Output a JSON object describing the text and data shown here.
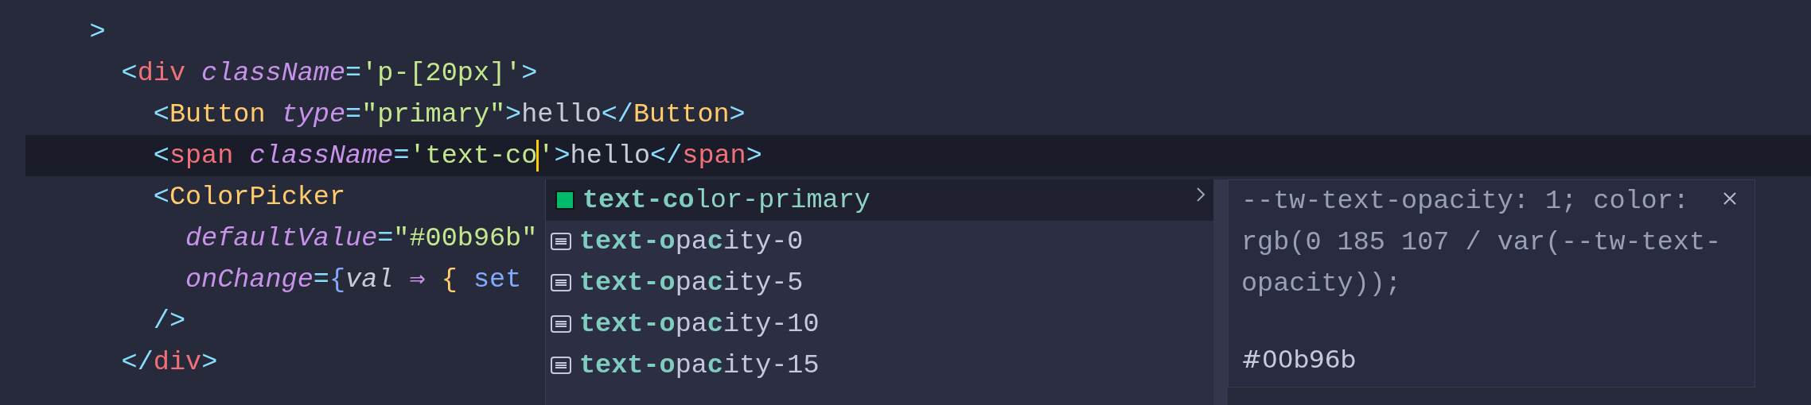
{
  "editor": {
    "lines": [
      {
        "current": false,
        "tokens": [
          {
            "text": ">",
            "kind": "punct"
          }
        ],
        "children": [
          {
            "current": false,
            "tokens": [
              {
                "text": "<",
                "kind": "punct"
              },
              {
                "text": "div",
                "kind": "tag"
              },
              {
                "text": " className",
                "kind": "attr"
              },
              {
                "text": "=",
                "kind": "punct"
              },
              {
                "text": "'p-[20px]'",
                "kind": "string"
              },
              {
                "text": ">",
                "kind": "punct"
              }
            ],
            "children": [
              {
                "current": false,
                "tokens": [
                  {
                    "text": "<",
                    "kind": "punct"
                  },
                  {
                    "text": "Button",
                    "kind": "component"
                  },
                  {
                    "text": " type",
                    "kind": "attr"
                  },
                  {
                    "text": "=",
                    "kind": "punct"
                  },
                  {
                    "text": "\"primary\"",
                    "kind": "string"
                  },
                  {
                    "text": ">",
                    "kind": "punct"
                  },
                  {
                    "text": "hello",
                    "kind": "text"
                  },
                  {
                    "text": "</",
                    "kind": "punct"
                  },
                  {
                    "text": "Button",
                    "kind": "component"
                  },
                  {
                    "text": ">",
                    "kind": "punct"
                  }
                ]
              },
              {
                "current": true,
                "tokens": [
                  {
                    "text": "<",
                    "kind": "punct"
                  },
                  {
                    "text": "span",
                    "kind": "tag"
                  },
                  {
                    "text": " className",
                    "kind": "attr"
                  },
                  {
                    "text": "=",
                    "kind": "punct"
                  },
                  {
                    "text": "'text-co",
                    "kind": "string"
                  },
                  {
                    "kind": "cursor"
                  },
                  {
                    "text": "'",
                    "kind": "string"
                  },
                  {
                    "text": ">",
                    "kind": "punct"
                  },
                  {
                    "text": "hello",
                    "kind": "text"
                  },
                  {
                    "text": "</",
                    "kind": "punct"
                  },
                  {
                    "text": "span",
                    "kind": "tag"
                  },
                  {
                    "text": ">",
                    "kind": "punct"
                  }
                ]
              },
              {
                "current": false,
                "tokens": [
                  {
                    "text": "<",
                    "kind": "punct"
                  },
                  {
                    "text": "ColorPicker",
                    "kind": "component"
                  }
                ],
                "children": [
                  {
                    "current": false,
                    "tokens": [
                      {
                        "text": "defaultValue",
                        "kind": "attr"
                      },
                      {
                        "text": "=",
                        "kind": "punct"
                      },
                      {
                        "text": "\"#00b96b\"",
                        "kind": "string"
                      }
                    ]
                  },
                  {
                    "current": false,
                    "tokens": [
                      {
                        "text": "onChange",
                        "kind": "attr"
                      },
                      {
                        "text": "=",
                        "kind": "punct"
                      },
                      {
                        "text": "{",
                        "kind": "brace1"
                      },
                      {
                        "text": "val",
                        "kind": "param"
                      },
                      {
                        "text": " ⇒ ",
                        "kind": "arrow"
                      },
                      {
                        "text": "{",
                        "kind": "brace2"
                      },
                      {
                        "text": " set",
                        "kind": "fn"
                      }
                    ]
                  }
                ]
              },
              {
                "current": false,
                "tokens": [
                  {
                    "text": "/>",
                    "kind": "punct"
                  }
                ]
              }
            ]
          },
          {
            "current": false,
            "tokens": [
              {
                "text": "</",
                "kind": "punct"
              },
              {
                "text": "div",
                "kind": "tag"
              },
              {
                "text": ">",
                "kind": "punct"
              }
            ]
          }
        ]
      }
    ]
  },
  "suggestions": [
    {
      "kind": "color",
      "color": "#00b96b",
      "label": "**text-co**lor-primary",
      "selected": true
    },
    {
      "kind": "class",
      "label": "**text-o**pa**c**ity-0",
      "selected": false
    },
    {
      "kind": "class",
      "label": "**text-o**pa**c**ity-5",
      "selected": false
    },
    {
      "kind": "class",
      "label": "**text-o**pa**c**ity-10",
      "selected": false
    },
    {
      "kind": "class",
      "label": "**text-o**pa**c**ity-15",
      "selected": false
    }
  ],
  "details": {
    "css": "--tw-text-opacity: 1; color: rgb(0 185 107 / var(--tw-text-opacity));",
    "value": "#00b96b"
  }
}
